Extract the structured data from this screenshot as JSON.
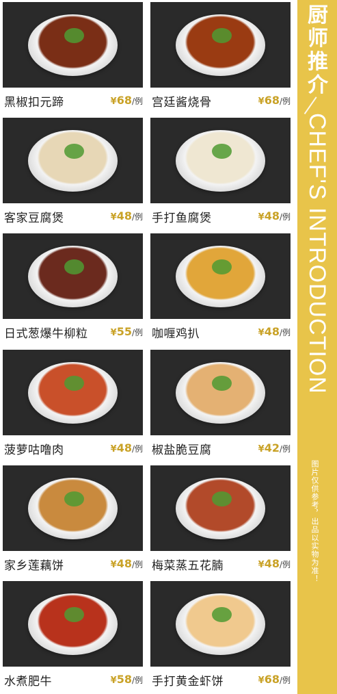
{
  "menu": {
    "currency": "¥",
    "unit": "/例",
    "dishes": [
      {
        "name": "黑椒扣元蹄",
        "price": "68",
        "color": "#7a2e16"
      },
      {
        "name": "宫廷酱烧骨",
        "price": "68",
        "color": "#9a3b12"
      },
      {
        "name": "客家豆腐煲",
        "price": "48",
        "color": "#e7d7b6"
      },
      {
        "name": "手打鱼腐煲",
        "price": "48",
        "color": "#efe7d2"
      },
      {
        "name": "日式葱爆牛柳粒",
        "price": "55",
        "color": "#6b2a1e"
      },
      {
        "name": "咖喱鸡扒",
        "price": "48",
        "color": "#e1a63a"
      },
      {
        "name": "菠萝咕噜肉",
        "price": "48",
        "color": "#c9502a"
      },
      {
        "name": "椒盐脆豆腐",
        "price": "42",
        "color": "#e4b173"
      },
      {
        "name": "家乡莲藕饼",
        "price": "48",
        "color": "#c98a3e"
      },
      {
        "name": "梅菜蒸五花腩",
        "price": "48",
        "color": "#b24a2a"
      },
      {
        "name": "水煮肥牛",
        "price": "58",
        "color": "#b8321c"
      },
      {
        "name": "手打黄金虾饼",
        "price": "68",
        "color": "#f0c98e"
      }
    ]
  },
  "sidebar": {
    "title_cn": [
      "厨",
      "师",
      "推",
      "介"
    ],
    "title_en": "CHEF'S INTRODUCTION",
    "note": "图片仅供参考，出品以实物为准！",
    "background": "#e8c44a"
  }
}
